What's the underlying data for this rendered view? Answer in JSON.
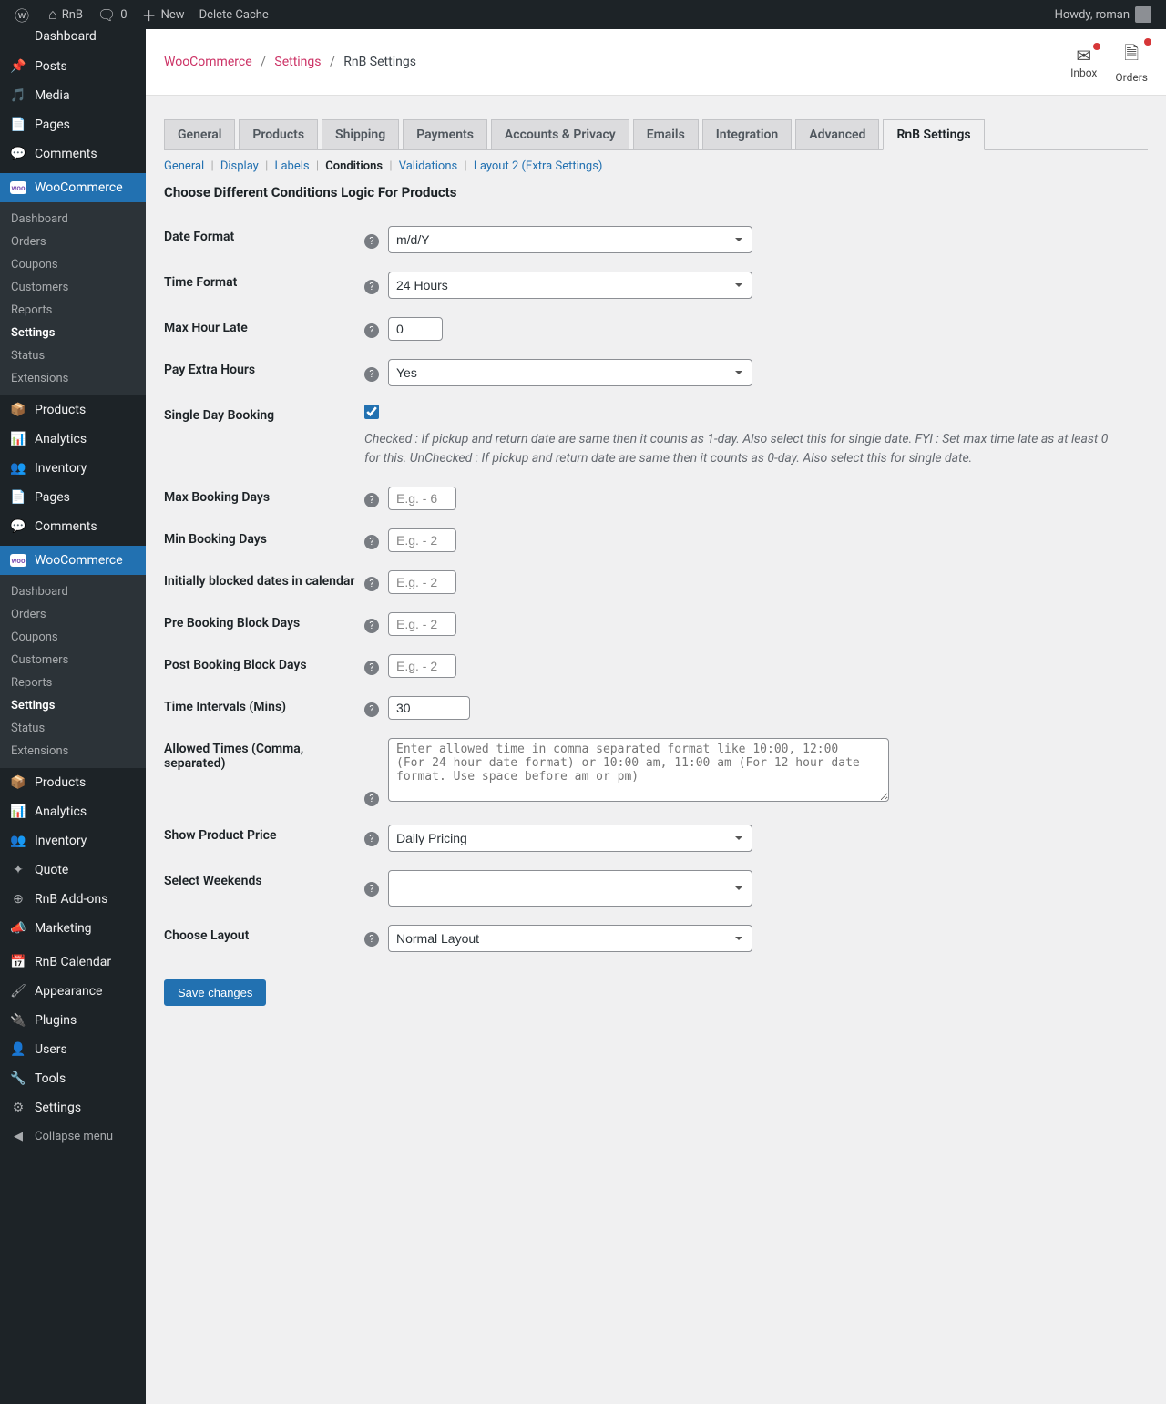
{
  "adminbar": {
    "site_name": "RnB",
    "comments_count": "0",
    "new_label": "New",
    "delete_cache_label": "Delete Cache",
    "howdy": "Howdy, roman"
  },
  "sidebar": {
    "dashboard_top": "Dashboard",
    "items_top": [
      {
        "label": "Posts",
        "icon": "pin"
      },
      {
        "label": "Media",
        "icon": "media"
      },
      {
        "label": "Pages",
        "icon": "page"
      },
      {
        "label": "Comments",
        "icon": "comment"
      }
    ],
    "woo_label": "WooCommerce",
    "woo_sub": [
      {
        "label": "Dashboard"
      },
      {
        "label": "Orders"
      },
      {
        "label": "Coupons"
      },
      {
        "label": "Customers"
      },
      {
        "label": "Reports"
      },
      {
        "label": "Settings",
        "current": true
      },
      {
        "label": "Status"
      },
      {
        "label": "Extensions"
      }
    ],
    "items_mid": [
      {
        "label": "Products",
        "icon": "box"
      },
      {
        "label": "Analytics",
        "icon": "bars"
      },
      {
        "label": "Inventory",
        "icon": "users"
      },
      {
        "label": "Pages",
        "icon": "page"
      },
      {
        "label": "Comments",
        "icon": "comment"
      }
    ],
    "woo_sub2": [
      {
        "label": "Dashboard"
      },
      {
        "label": "Orders"
      },
      {
        "label": "Coupons"
      },
      {
        "label": "Customers"
      },
      {
        "label": "Reports"
      },
      {
        "label": "Settings",
        "current": true
      },
      {
        "label": "Status"
      },
      {
        "label": "Extensions"
      }
    ],
    "items_bottom": [
      {
        "label": "Products",
        "icon": "box"
      },
      {
        "label": "Analytics",
        "icon": "bars"
      },
      {
        "label": "Inventory",
        "icon": "users"
      },
      {
        "label": "Quote",
        "icon": "plus"
      },
      {
        "label": "RnB Add-ons",
        "icon": "plus-circle"
      },
      {
        "label": "Marketing",
        "icon": "megaphone"
      }
    ],
    "items_admin": [
      {
        "label": "RnB Calendar",
        "icon": "calendar"
      },
      {
        "label": "Appearance",
        "icon": "brush"
      },
      {
        "label": "Plugins",
        "icon": "plug"
      },
      {
        "label": "Users",
        "icon": "user"
      },
      {
        "label": "Tools",
        "icon": "wrench"
      },
      {
        "label": "Settings",
        "icon": "sliders"
      }
    ],
    "collapse_label": "Collapse menu"
  },
  "header": {
    "bc_woo": "WooCommerce",
    "bc_settings": "Settings",
    "bc_current": "RnB Settings",
    "inbox_label": "Inbox",
    "orders_label": "Orders"
  },
  "tabs": [
    "General",
    "Products",
    "Shipping",
    "Payments",
    "Accounts & Privacy",
    "Emails",
    "Integration",
    "Advanced",
    "RnB Settings"
  ],
  "active_tab": "RnB Settings",
  "subtabs": [
    "General",
    "Display",
    "Labels",
    "Conditions",
    "Validations",
    "Layout 2 (Extra Settings)"
  ],
  "active_subtab": "Conditions",
  "section_title": "Choose Different Conditions Logic For Products",
  "fields": {
    "date_format": {
      "label": "Date Format",
      "value": "m/d/Y"
    },
    "time_format": {
      "label": "Time Format",
      "value": "24 Hours"
    },
    "max_hour_late": {
      "label": "Max Hour Late",
      "value": "0"
    },
    "pay_extra": {
      "label": "Pay Extra Hours",
      "value": "Yes"
    },
    "single_day": {
      "label": "Single Day Booking",
      "desc": "Checked : If pickup and return date are same then it counts as 1-day. Also select this for single date. FYI : Set max time late as at least 0 for this. UnChecked : If pickup and return date are same then it counts as 0-day. Also select this for single date."
    },
    "max_booking": {
      "label": "Max Booking Days",
      "placeholder": "E.g. - 6"
    },
    "min_booking": {
      "label": "Min Booking Days",
      "placeholder": "E.g. - 2"
    },
    "init_blocked": {
      "label": "Initially blocked dates in calendar",
      "placeholder": "E.g. - 2"
    },
    "pre_block": {
      "label": "Pre Booking Block Days",
      "placeholder": "E.g. - 2"
    },
    "post_block": {
      "label": "Post Booking Block Days",
      "placeholder": "E.g. - 2"
    },
    "time_intervals": {
      "label": "Time Intervals (Mins)",
      "value": "30"
    },
    "allowed_times": {
      "label": "Allowed Times (Comma, separated)",
      "placeholder": "Enter allowed time in comma separated format like 10:00, 12:00 (For 24 hour date format) or 10:00 am, 11:00 am (For 12 hour date format. Use space before am or pm)"
    },
    "show_price": {
      "label": "Show Product Price",
      "value": "Daily Pricing"
    },
    "weekends": {
      "label": "Select Weekends"
    },
    "layout": {
      "label": "Choose Layout",
      "value": "Normal Layout"
    }
  },
  "save_label": "Save changes"
}
